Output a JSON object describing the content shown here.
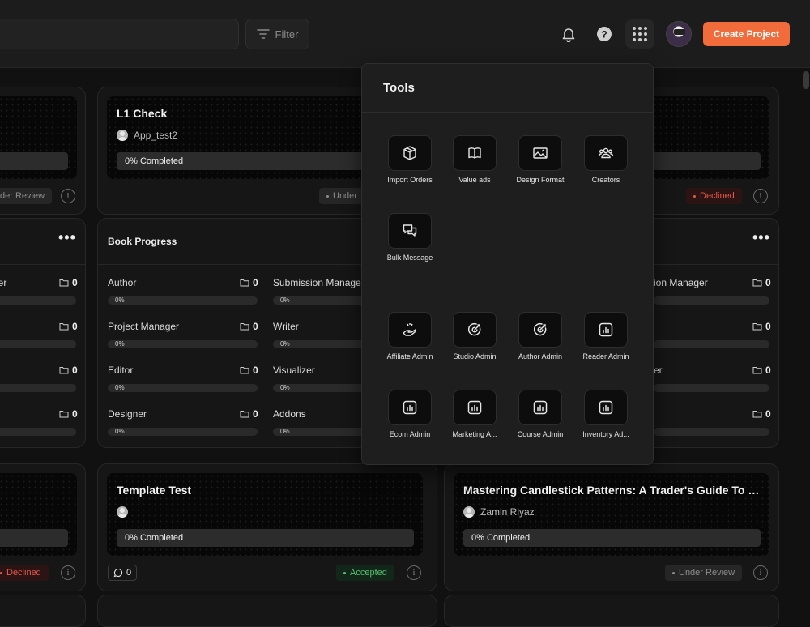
{
  "topbar": {
    "filter_label": "Filter",
    "create_label": "Create Project"
  },
  "cards": {
    "left_top": {
      "status": "der Review"
    },
    "l1": {
      "title": "L1 Check",
      "user": "App_test2",
      "progress": "0% Completed",
      "status": "Under"
    },
    "right_top": {
      "status": "Declined"
    },
    "template": {
      "title": "Template Test",
      "user": "",
      "progress": "0% Completed",
      "comments": "0",
      "status": "Accepted"
    },
    "mastering": {
      "title": "Mastering Candlestick Patterns: A Trader's Guide To Mar...",
      "user": "Zamin Riyaz",
      "progress": "0% Completed",
      "status": "Under Review"
    },
    "left_bottom": {
      "status": "Declined"
    }
  },
  "book_progress": {
    "title": "Book Progress",
    "left_roles": [
      {
        "label": "ger",
        "count": "0"
      },
      {
        "label": "",
        "count": "0"
      },
      {
        "label": "",
        "count": "0"
      },
      {
        "label": "",
        "count": "0"
      }
    ],
    "col1": [
      {
        "label": "Author",
        "count": "0",
        "pct": "0%"
      },
      {
        "label": "Project Manager",
        "count": "0",
        "pct": "0%"
      },
      {
        "label": "Editor",
        "count": "0",
        "pct": "0%"
      },
      {
        "label": "Designer",
        "count": "0",
        "pct": "0%"
      }
    ],
    "col2": [
      {
        "label": "Submission Manager",
        "pct": "0%"
      },
      {
        "label": "Writer",
        "pct": "0%"
      },
      {
        "label": "Visualizer",
        "pct": "0%"
      },
      {
        "label": "Addons",
        "pct": "0%"
      }
    ],
    "right_roles": [
      {
        "label": "sion Manager",
        "count": "0"
      },
      {
        "label": "",
        "count": "0"
      },
      {
        "label": "er",
        "count": "0"
      },
      {
        "label": "",
        "count": "0"
      }
    ]
  },
  "tools": {
    "title": "Tools",
    "items": [
      {
        "label": "Import Orders",
        "icon": "box-icon"
      },
      {
        "label": "Value ads",
        "icon": "book-icon"
      },
      {
        "label": "Design Format",
        "icon": "image-icon"
      },
      {
        "label": "Creators",
        "icon": "users-icon"
      },
      {
        "label": "Bulk Message",
        "icon": "chat-icon"
      },
      {
        "label": "Affiliate Admin",
        "icon": "hand-coin-icon"
      },
      {
        "label": "Studio Admin",
        "icon": "target-icon"
      },
      {
        "label": "Author Admin",
        "icon": "target-icon"
      },
      {
        "label": "Reader Admin",
        "icon": "chart-icon"
      },
      {
        "label": "Ecom Admin",
        "icon": "chart-icon"
      },
      {
        "label": "Marketing A...",
        "icon": "chart-icon"
      },
      {
        "label": "Course Admin",
        "icon": "chart-icon"
      },
      {
        "label": "Inventory Ad...",
        "icon": "chart-icon"
      }
    ]
  }
}
